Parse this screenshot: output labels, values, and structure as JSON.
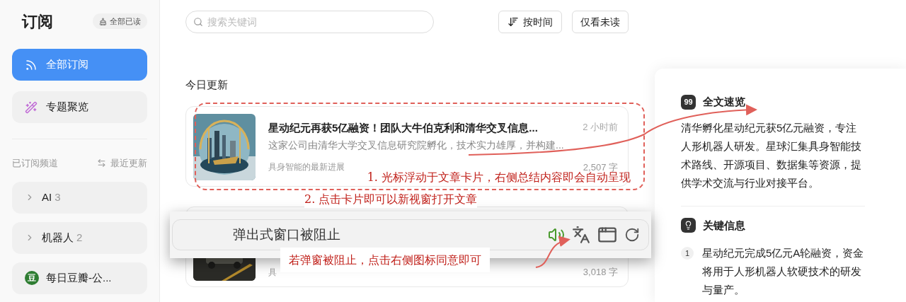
{
  "sidebar": {
    "title": "订阅",
    "mark_all_read": "全部已读",
    "nav": [
      {
        "kind": "rss",
        "label": "全部订阅",
        "selected": true
      },
      {
        "kind": "topics",
        "label": "专题聚览",
        "selected": false
      }
    ],
    "section_label": "已订阅频道",
    "sort_label": "最近更新",
    "channels": [
      {
        "kind": "folder",
        "name": "AI",
        "count": "3",
        "expanded": false
      },
      {
        "kind": "folder",
        "name": "机器人",
        "count": "2",
        "expanded": false
      },
      {
        "kind": "feed",
        "name": "每日豆瓣-公...",
        "badge": "豆"
      }
    ]
  },
  "toolbar": {
    "search": {
      "placeholder": "搜索关键词"
    },
    "sort_button": "按时间",
    "unread_button": "仅看未读"
  },
  "feed": {
    "section_title": "今日更新",
    "articles": [
      {
        "kind": "full",
        "title": "星动纪元再获5亿融资！团队大牛伯克利和清华交叉信息...",
        "time": "2 小时前",
        "summary": "这家公司由清华大学交叉信息研究院孵化，技术实力雄厚，并构建...",
        "source": "具身智能的最新进展",
        "words": "2,507 字"
      },
      {
        "kind": "covered",
        "source": "具",
        "words": "3,018 字"
      }
    ]
  },
  "summary_panel": {
    "sections": [
      {
        "kind": "overview",
        "icon": "99",
        "title": "全文速览",
        "text": "清华孵化星动纪元获5亿元融资，专注人形机器人研发。星球汇集具身智能技术路线、开源项目、数据集等资源，提供学术交流与行业对接平台。"
      },
      {
        "kind": "key_points",
        "title": "关键信息",
        "items": [
          {
            "number": "1",
            "text": "星动纪元完成5亿元A轮融资，资金将用于人形机器人软硬技术的研发与量产。"
          }
        ]
      }
    ]
  },
  "popup_bar": {
    "message": "弹出式窗口被阻止"
  },
  "annotations": [
    {
      "kind": "callout",
      "text": "1. 光标浮动于文章卡片，右侧总结内容即会自动呈现"
    },
    {
      "kind": "note",
      "text": "2. 点击卡片即可以新视窗打开文章"
    },
    {
      "kind": "boxed",
      "text": "若弹窗被阻止，点击右侧图标同意即可"
    }
  ]
}
